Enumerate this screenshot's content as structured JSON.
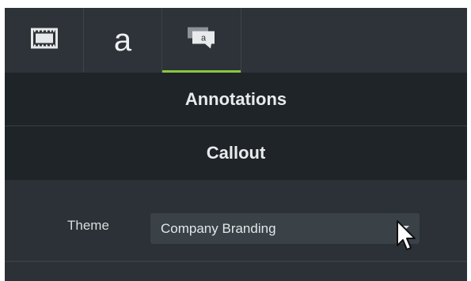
{
  "tabs": [
    {
      "icon": "film-strip-icon",
      "active": false
    },
    {
      "label": "a",
      "icon": "text-a-icon",
      "active": false
    },
    {
      "icon": "speech-callout-icon",
      "glyph": "a",
      "active": true
    }
  ],
  "sections": {
    "annotations_title": "Annotations",
    "callout_title": "Callout"
  },
  "theme": {
    "label": "Theme",
    "value": "Company Branding"
  },
  "colors": {
    "accent": "#8cc63f",
    "panel": "#2b3136",
    "header": "#1e2427"
  }
}
